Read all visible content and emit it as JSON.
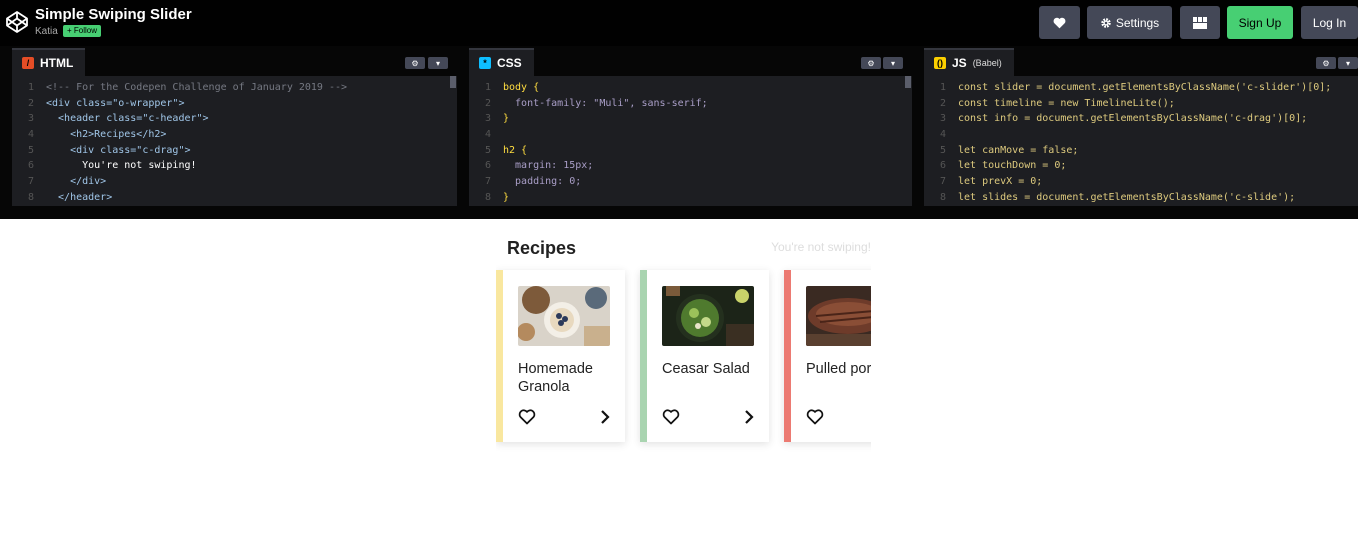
{
  "header": {
    "title": "Simple Swiping Slider",
    "author": "Katia",
    "follow_label": "+ Follow",
    "buttons": {
      "settings": "Settings",
      "signup": "Sign Up",
      "login": "Log In"
    }
  },
  "editors": {
    "html": {
      "label": "HTML",
      "lines": [
        "<!-- For the Codepen Challenge of January 2019 -->",
        "<div class=\"o-wrapper\">",
        "  <header class=\"c-header\">",
        "    <h2>Recipes</h2>",
        "    <div class=\"c-drag\">",
        "      You're not swiping!",
        "    </div>",
        "  </header>"
      ]
    },
    "css": {
      "label": "CSS",
      "lines": [
        "body {",
        "  font-family: \"Muli\", sans-serif;",
        "}",
        "",
        "h2 {",
        "  margin: 15px;",
        "  padding: 0;",
        "}"
      ]
    },
    "js": {
      "label": "JS",
      "sublabel": "(Babel)",
      "lines": [
        "const slider = document.getElementsByClassName('c-slider')[0];",
        "const timeline = new TimelineLite();",
        "const info = document.getElementsByClassName('c-drag')[0];",
        "",
        "let canMove = false;",
        "let touchDown = 0;",
        "let prevX = 0;",
        "let slides = document.getElementsByClassName('c-slide');"
      ]
    }
  },
  "result": {
    "heading": "Recipes",
    "drag_status": "You're not swiping!",
    "cards": [
      {
        "name": "Homemade Granola",
        "stripe": "#f9e79f"
      },
      {
        "name": "Ceasar Salad",
        "stripe": "#a9d4b0"
      },
      {
        "name": "Pulled pork",
        "stripe": "#ec7a72"
      }
    ]
  },
  "colors": {
    "topbar": "#010101",
    "button": "#444857",
    "accent_green": "#47cf73",
    "editor_bg": "#1d1e22"
  }
}
